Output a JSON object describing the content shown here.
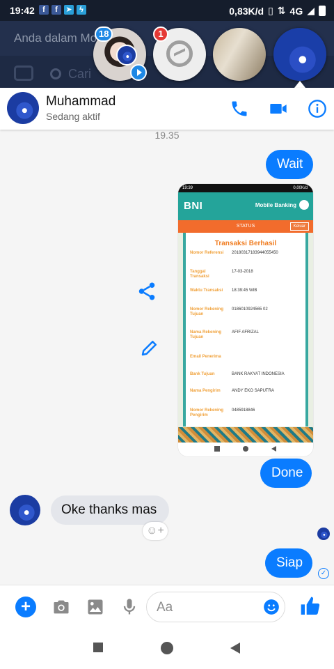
{
  "status_bar": {
    "time": "19:42",
    "network_speed": "0,83K/d",
    "network_type": "4G",
    "app_icons": [
      "facebook-icon",
      "facebook-icon",
      "telegram-icon",
      "messenger-icon"
    ]
  },
  "background_app": {
    "banner_text": "Anda dalam Mo",
    "search_placeholder": "Cari"
  },
  "chat_heads": [
    {
      "name": "profile-photo",
      "badge": "18"
    },
    {
      "name": "messenger-logo",
      "badge": "1"
    },
    {
      "name": "group-photo",
      "badge": ""
    },
    {
      "name": "active-chat",
      "badge": ""
    }
  ],
  "chat_header": {
    "name": "Muhammad",
    "status": "Sedang aktif"
  },
  "messages": {
    "timestamp": "19.35",
    "wait": "Wait",
    "done": "Done",
    "oke": "Oke thanks mas",
    "siap": "Siap"
  },
  "shared_image": {
    "status_time": "19:39",
    "status_speed": "0,00K/d",
    "bank_logo": "BNI",
    "app_title": "Mobile Banking",
    "tab_label": "STATUS",
    "exit_label": "Keluar",
    "title": "Transaksi Berhasil",
    "rows": [
      {
        "key": "Nomor Referensi",
        "value": "20180317183944055450"
      },
      {
        "key": "Tanggal Transaksi",
        "value": "17-03-2018"
      },
      {
        "key": "Waktu Transaksi",
        "value": "18:39:45 WIB"
      },
      {
        "key": "Nomor Rekening Tujuan",
        "value": "0186010924565 02"
      },
      {
        "key": "Nama Rekening Tujuan",
        "value": "AFIF AFRIZAL"
      },
      {
        "key": "Email Penerima",
        "value": ""
      },
      {
        "key": "Bank Tujuan",
        "value": "BANK RAKYAT INDONESIA"
      },
      {
        "key": "Nama Pengirim",
        "value": "ANDY EKO SAPUTRA"
      },
      {
        "key": "Nomor Rekening Pengirim",
        "value": "0485918846"
      }
    ]
  },
  "composer": {
    "placeholder": "Aa",
    "value": ""
  },
  "colors": {
    "accent": "#0a7cff",
    "incoming_bubble": "#e4e6eb",
    "bni_teal": "#24a49a",
    "bni_orange": "#f26c2c"
  }
}
